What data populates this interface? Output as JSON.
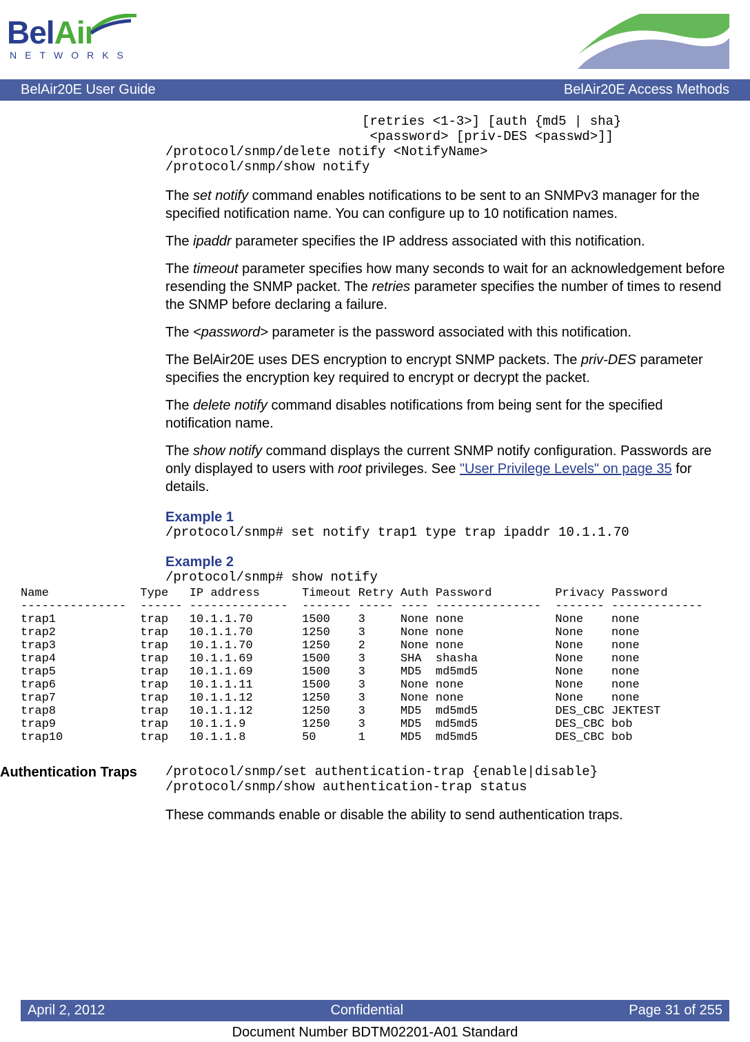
{
  "header": {
    "logo_bel": "Bel",
    "logo_air": "Air",
    "networks": "NETWORKS",
    "title_left": "BelAir20E User Guide",
    "title_right": "BelAir20E Access Methods"
  },
  "code_block1": "                         [retries <1-3>] [auth {md5 | sha}\n                          <password> [priv-DES <passwd>]]\n/protocol/snmp/delete notify <NotifyName>\n/protocol/snmp/show notify",
  "paragraphs": {
    "p1a": "The ",
    "p1b": "set notify",
    "p1c": " command enables notifications to be sent to an SNMPv3 manager for the specified notification name. You can configure up to 10 notification names.",
    "p2a": "The ",
    "p2b": "ipaddr",
    "p2c": " parameter specifies the IP address associated with this notification.",
    "p3a": "The ",
    "p3b": "timeout",
    "p3c": " parameter specifies how many seconds to wait for an acknowledgement before resending the SNMP packet. The ",
    "p3d": "retries",
    "p3e": " parameter specifies the number of times to resend the SNMP before declaring a failure.",
    "p4a": "The ",
    "p4b": "<password>",
    "p4c": " parameter is the password associated with this notification.",
    "p5a": "The BelAir20E uses DES encryption to encrypt SNMP packets. The ",
    "p5b": "priv-DES",
    "p5c": " parameter specifies the encryption key required to encrypt or decrypt the packet.",
    "p6a": "The ",
    "p6b": "delete notify",
    "p6c": " command disables notifications from being sent for the specified notification name.",
    "p7a": "The ",
    "p7b": "show notify",
    "p7c": " command displays the current SNMP notify configuration. Passwords are only displayed to users with ",
    "p7d": "root",
    "p7e": " privileges. See ",
    "p7link": "\"User Privilege Levels\" on page 35",
    "p7f": " for details."
  },
  "example1": {
    "title": "Example 1",
    "code": "/protocol/snmp# set notify trap1 type trap ipaddr 10.1.1.70"
  },
  "example2": {
    "title": "Example 2",
    "code": "/protocol/snmp# show notify"
  },
  "chart_data": {
    "type": "table",
    "columns": [
      "Name",
      "Type",
      "IP address",
      "Timeout",
      "Retry",
      "Auth",
      "Password",
      "Privacy",
      "Password"
    ],
    "rows": [
      [
        "trap1",
        "trap",
        "10.1.1.70",
        "1500",
        "3",
        "None",
        "none",
        "None",
        "none"
      ],
      [
        "trap2",
        "trap",
        "10.1.1.70",
        "1250",
        "3",
        "None",
        "none",
        "None",
        "none"
      ],
      [
        "trap3",
        "trap",
        "10.1.1.70",
        "1250",
        "2",
        "None",
        "none",
        "None",
        "none"
      ],
      [
        "trap4",
        "trap",
        "10.1.1.69",
        "1500",
        "3",
        "SHA",
        "shasha",
        "None",
        "none"
      ],
      [
        "trap5",
        "trap",
        "10.1.1.69",
        "1500",
        "3",
        "MD5",
        "md5md5",
        "None",
        "none"
      ],
      [
        "trap6",
        "trap",
        "10.1.1.11",
        "1500",
        "3",
        "None",
        "none",
        "None",
        "none"
      ],
      [
        "trap7",
        "trap",
        "10.1.1.12",
        "1250",
        "3",
        "None",
        "none",
        "None",
        "none"
      ],
      [
        "trap8",
        "trap",
        "10.1.1.12",
        "1250",
        "3",
        "MD5",
        "md5md5",
        "DES_CBC",
        "JEKTEST"
      ],
      [
        "trap9",
        "trap",
        "10.1.1.9",
        "1250",
        "3",
        "MD5",
        "md5md5",
        "DES_CBC",
        "bob"
      ],
      [
        "trap10",
        "trap",
        "10.1.1.8",
        "50",
        "1",
        "MD5",
        "md5md5",
        "DES_CBC",
        "bob"
      ]
    ]
  },
  "table_text": "Name             Type   IP address      Timeout Retry Auth Password         Privacy Password\n---------------  ------ --------------  ------- ----- ---- ---------------  ------- -------------\ntrap1            trap   10.1.1.70       1500    3     None none             None    none\ntrap2            trap   10.1.1.70       1250    3     None none             None    none\ntrap3            trap   10.1.1.70       1250    2     None none             None    none\ntrap4            trap   10.1.1.69       1500    3     SHA  shasha           None    none\ntrap5            trap   10.1.1.69       1500    3     MD5  md5md5           None    none\ntrap6            trap   10.1.1.11       1500    3     None none             None    none\ntrap7            trap   10.1.1.12       1250    3     None none             None    none\ntrap8            trap   10.1.1.12       1250    3     MD5  md5md5           DES_CBC JEKTEST\ntrap9            trap   10.1.1.9        1250    3     MD5  md5md5           DES_CBC bob\ntrap10           trap   10.1.1.8        50      1     MD5  md5md5           DES_CBC bob",
  "auth_traps": {
    "label": "Authentication Traps",
    "code": "/protocol/snmp/set authentication-trap {enable|disable}\n/protocol/snmp/show authentication-trap status",
    "desc": "These commands enable or disable the ability to send authentication traps."
  },
  "footer": {
    "date": "April 2, 2012",
    "conf": "Confidential",
    "page": "Page 31 of 255",
    "docnum": "Document Number BDTM02201-A01 Standard"
  }
}
